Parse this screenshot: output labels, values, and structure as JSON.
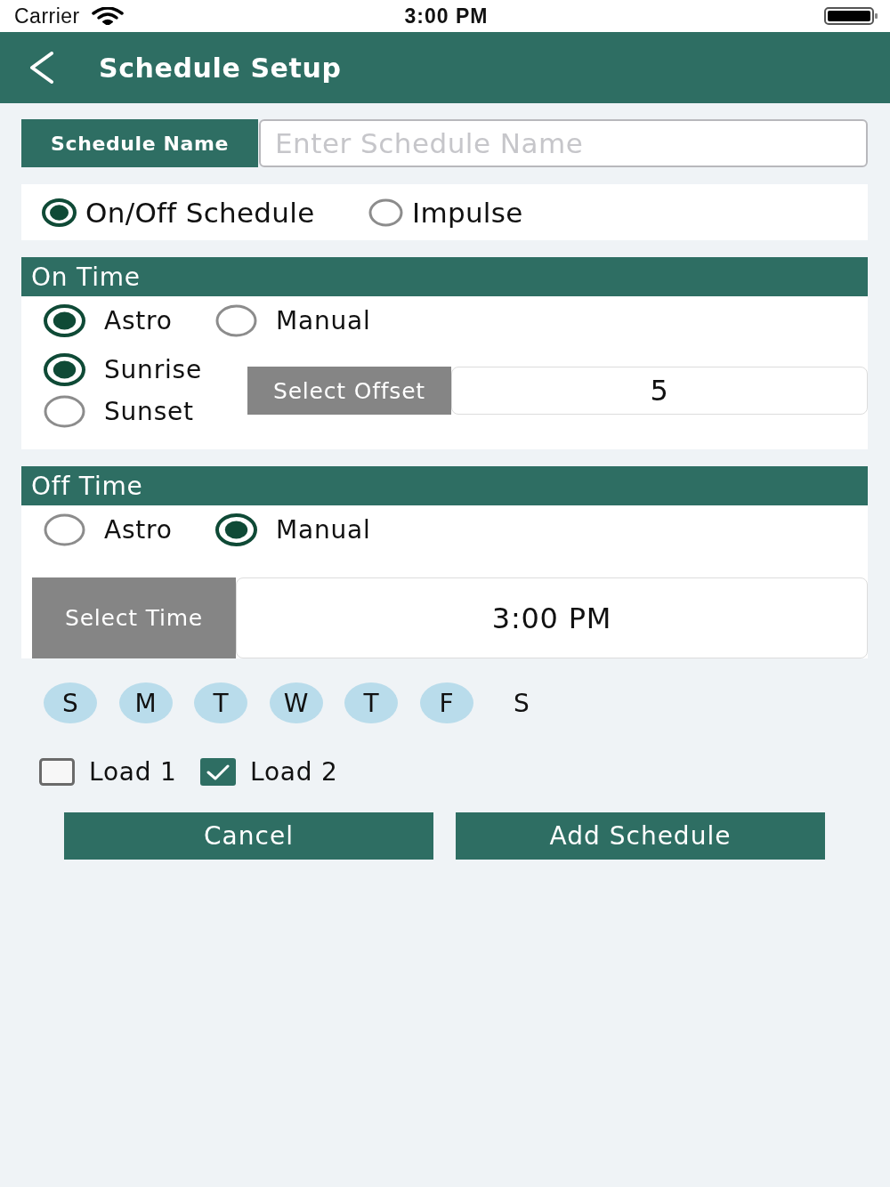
{
  "status_bar": {
    "carrier": "Carrier",
    "time": "3:00 PM"
  },
  "nav_bar": {
    "title": "Schedule Setup"
  },
  "schedule_name": {
    "label": "Schedule Name",
    "placeholder": "Enter Schedule Name"
  },
  "schedule_types": [
    {
      "label": "On/Off Schedule",
      "selected": true
    },
    {
      "label": "Impulse",
      "selected": false
    }
  ],
  "on_time": {
    "title": "On Time",
    "modes": [
      {
        "label": "Astro",
        "selected": true
      },
      {
        "label": "Manual",
        "selected": false
      }
    ],
    "events": [
      {
        "label": "Sunrise",
        "selected": true
      },
      {
        "label": "Sunset",
        "selected": false
      }
    ],
    "picker": {
      "label": "Select Offset",
      "value": "5"
    }
  },
  "off_time": {
    "title": "Off Time",
    "modes": [
      {
        "label": "Astro",
        "selected": false
      },
      {
        "label": "Manual",
        "selected": true
      }
    ],
    "picker": {
      "label": "Select Time",
      "value": "3:00 PM"
    }
  },
  "days": [
    {
      "label": "S",
      "selected": true
    },
    {
      "label": "M",
      "selected": true
    },
    {
      "label": "T",
      "selected": true
    },
    {
      "label": "W",
      "selected": true
    },
    {
      "label": "T",
      "selected": true
    },
    {
      "label": "F",
      "selected": true
    },
    {
      "label": "S",
      "selected": false
    }
  ],
  "loads": [
    {
      "label": "Load 1",
      "checked": false
    },
    {
      "label": "Load 2",
      "checked": true
    }
  ],
  "buttons": [
    {
      "label": "Cancel"
    },
    {
      "label": "Add Schedule"
    }
  ]
}
